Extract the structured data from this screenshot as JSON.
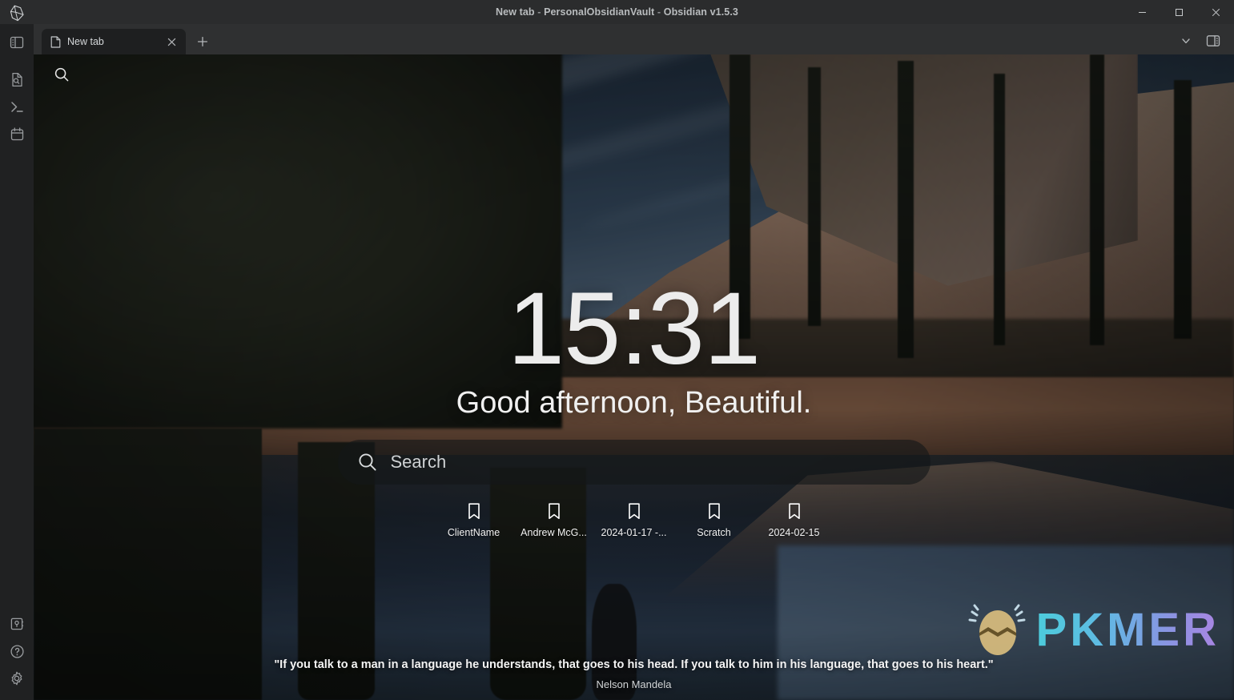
{
  "window": {
    "title": "New tab - PersonalObsidianVault - Obsidian v1.5.3",
    "title_doc": "New tab",
    "title_sep1": " - ",
    "title_vault": "PersonalObsidianVault",
    "title_sep2": " - ",
    "title_app": "Obsidian v1.5.3",
    "minimize_label": "—",
    "maximize_label": "□",
    "close_label": "✕",
    "app_logo_icon": "obsidian-gem-icon"
  },
  "ribbon": {
    "toggle_icon": "toggle-left-sidebar-icon",
    "items": [
      {
        "icon": "file-search-icon",
        "label": "Quick switcher"
      },
      {
        "icon": "terminal-icon",
        "label": "Command palette"
      },
      {
        "icon": "calendar-icon",
        "label": "Calendar"
      }
    ],
    "bottom_items": [
      {
        "icon": "vault-switcher-icon",
        "label": "Open another vault"
      },
      {
        "icon": "help-circle-icon",
        "label": "Help"
      },
      {
        "icon": "settings-gear-icon",
        "label": "Settings"
      }
    ]
  },
  "tabbar": {
    "tabs": [
      {
        "icon": "file-icon",
        "label": "New tab",
        "close_icon": "close-icon",
        "active": true
      }
    ],
    "new_tab_icon": "plus-icon",
    "new_tab_label": "+",
    "right_buttons": [
      {
        "icon": "chevron-down-icon",
        "label": "˅"
      },
      {
        "icon": "toggle-right-sidebar-icon",
        "label": ""
      }
    ]
  },
  "banner": {
    "search_icon": "search-icon",
    "clock": "15:31",
    "greeting": "Good afternoon, Beautiful.",
    "search": {
      "icon": "search-icon",
      "placeholder": "Search",
      "value": ""
    },
    "bookmarks": [
      {
        "icon": "bookmark-icon",
        "label": "ClientName"
      },
      {
        "icon": "bookmark-icon",
        "label": "Andrew McG..."
      },
      {
        "icon": "bookmark-icon",
        "label": "2024-01-17 -..."
      },
      {
        "icon": "bookmark-icon",
        "label": "Scratch"
      },
      {
        "icon": "bookmark-icon",
        "label": "2024-02-15"
      }
    ],
    "quote": "\"If you talk to a man in a language he understands, that goes to his head. If you talk to him in his language, that goes to his heart.\"",
    "quote_author": "Nelson Mandela"
  },
  "watermark": {
    "text": "PKMER",
    "logo_icon": "pkmer-egg-icon"
  },
  "colors": {
    "titlebar_bg": "#2b2c2d",
    "tabbar_bg": "#2f3031",
    "ribbon_bg": "#202122",
    "active_tab_bg": "#1e1f20",
    "text_primary": "#d4d7d9",
    "text_muted": "#8f9295",
    "accent_cyan": "#4fd8e8",
    "accent_purple": "#b58bf0",
    "close_hover": "#c42b1c"
  }
}
